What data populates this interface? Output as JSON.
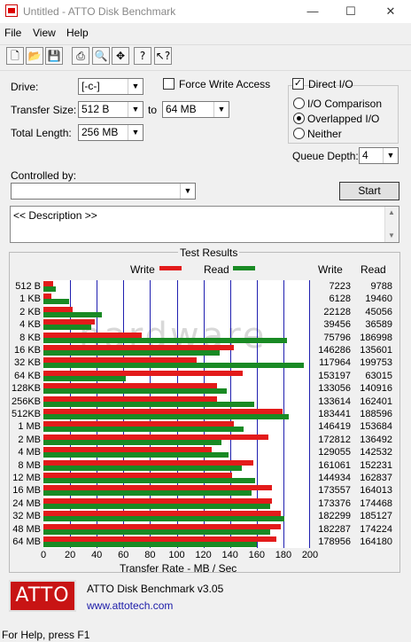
{
  "window": {
    "title": "Untitled - ATTO Disk Benchmark",
    "minimize": "—",
    "maximize": "☐",
    "close": "✕"
  },
  "menu": [
    "File",
    "View",
    "Help"
  ],
  "toolbar": {
    "icons": [
      "new-icon",
      "open-icon",
      "save-icon",
      "print-icon",
      "print-preview-icon",
      "move-icon",
      "help-icon",
      "context-help-icon"
    ]
  },
  "form": {
    "drive_label": "Drive:",
    "drive_value": "[-c-]",
    "force_write_label": "Force Write Access",
    "force_write_checked": false,
    "direct_io_label": "Direct I/O",
    "direct_io_checked": true,
    "transfer_size_label": "Transfer Size:",
    "transfer_from": "512 B",
    "to_label": "to",
    "transfer_to": "64 MB",
    "total_length_label": "Total Length:",
    "total_length": "256 MB",
    "io_comparison": "I/O Comparison",
    "overlapped_io": "Overlapped I/O",
    "neither": "Neither",
    "queue_depth_label": "Queue Depth:",
    "queue_depth": "4",
    "controlled_by_label": "Controlled by:",
    "controlled_by_value": "",
    "start_label": "Start",
    "description": "<< Description >>"
  },
  "results": {
    "title": "Test Results",
    "write_legend": "Write",
    "read_legend": "Read",
    "write_col": "Write",
    "read_col": "Read",
    "xlabel": "Transfer Rate - MB / Sec",
    "colors": {
      "write": "#e31b1b",
      "read": "#198a24",
      "grid": "#1f1fb0"
    }
  },
  "chart_data": {
    "type": "bar",
    "title": "Test Results",
    "xlabel": "Transfer Rate - MB / Sec",
    "xlim": [
      0,
      200
    ],
    "xticks": [
      "0",
      "20",
      "40",
      "60",
      "80",
      "100",
      "120",
      "140",
      "160",
      "180",
      "200"
    ],
    "categories": [
      "512 B",
      "1 KB",
      "2 KB",
      "4 KB",
      "8 KB",
      "16 KB",
      "32 KB",
      "64 KB",
      "128KB",
      "256KB",
      "512KB",
      "1 MB",
      "2 MB",
      "4 MB",
      "8 MB",
      "12 MB",
      "16 MB",
      "24 MB",
      "32 MB",
      "48 MB",
      "64 MB"
    ],
    "series": [
      {
        "name": "Write",
        "values": [
          7.1,
          6.0,
          21.6,
          38.5,
          74.0,
          142.9,
          115.2,
          149.6,
          130.0,
          130.5,
          179.1,
          143.0,
          168.8,
          126.0,
          157.4,
          141.5,
          171.4,
          171.3,
          178.0,
          178.0,
          174.8
        ],
        "labels": [
          "7223",
          "6128",
          "22128",
          "39456",
          "75796",
          "146286",
          "117964",
          "153197",
          "133056",
          "133614",
          "183441",
          "146419",
          "172812",
          "129055",
          "161061",
          "144934",
          "173557",
          "173376",
          "182299",
          "182287",
          "178956"
        ]
      },
      {
        "name": "Read",
        "values": [
          9.6,
          19.0,
          44.0,
          35.7,
          182.6,
          132.4,
          195.1,
          61.6,
          137.6,
          158.4,
          184.2,
          150.1,
          133.3,
          139.2,
          148.7,
          159.0,
          156.3,
          170.4,
          180.8,
          170.1,
          160.3
        ],
        "labels": [
          "9788",
          "19460",
          "45056",
          "36589",
          "186998",
          "135601",
          "199753",
          "63015",
          "140916",
          "162401",
          "188596",
          "153684",
          "136492",
          "142532",
          "152231",
          "162837",
          "164013",
          "174468",
          "185127",
          "174224",
          "164180"
        ]
      }
    ]
  },
  "watermark": "hardware",
  "footer": {
    "logo": "ATTO",
    "product": "ATTO Disk Benchmark v3.05",
    "url": "www.attotech.com"
  },
  "status": "For Help, press F1"
}
